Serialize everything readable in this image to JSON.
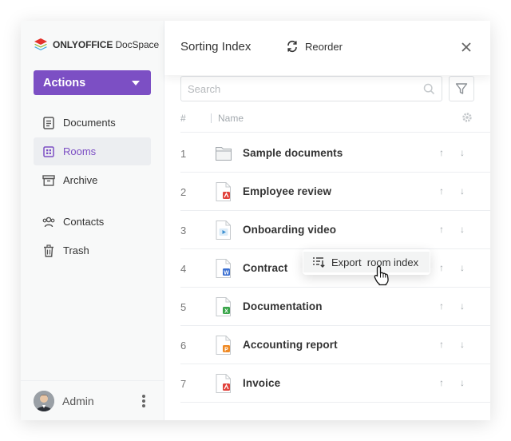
{
  "app": {
    "logo_brand": "ONLYOFFICE",
    "logo_product": "DocSpace"
  },
  "sidebar": {
    "actions_label": "Actions",
    "items": [
      {
        "label": "Documents",
        "icon": "document-icon",
        "active": false
      },
      {
        "label": "Rooms",
        "icon": "rooms-icon",
        "active": true
      },
      {
        "label": "Archive",
        "icon": "archive-icon",
        "active": false
      },
      {
        "label": "Contacts",
        "icon": "contacts-icon",
        "active": false
      },
      {
        "label": "Trash",
        "icon": "trash-icon",
        "active": false
      }
    ],
    "user_name": "Admin"
  },
  "panel": {
    "title": "Sorting Index",
    "reorder_label": "Reorder",
    "search_placeholder": "Search",
    "columns": {
      "index": "#",
      "name": "Name"
    },
    "rows": [
      {
        "index": "1",
        "name": "Sample documents",
        "type": "folder",
        "color": "#a3a9ae"
      },
      {
        "index": "2",
        "name": "Employee review",
        "type": "pdf",
        "color": "#e1423b"
      },
      {
        "index": "3",
        "name": "Onboarding video",
        "type": "video",
        "color": "#3b8fd1"
      },
      {
        "index": "4",
        "name": "Contract",
        "type": "docx",
        "color": "#3b6fd1",
        "badge": "W"
      },
      {
        "index": "5",
        "name": "Documentation",
        "type": "xlsx",
        "color": "#3aa54a",
        "badge": "X"
      },
      {
        "index": "6",
        "name": "Accounting report",
        "type": "pptx",
        "color": "#ef8a25",
        "badge": "P"
      },
      {
        "index": "7",
        "name": "Invoice",
        "type": "pdf",
        "color": "#e1423b"
      }
    ],
    "context_menu": {
      "label": "Export  room index",
      "icon": "export-index-icon"
    }
  },
  "colors": {
    "accent": "#7c4fc4",
    "sidebar_bg": "#f8f9f9",
    "active_bg": "#eceef1"
  }
}
